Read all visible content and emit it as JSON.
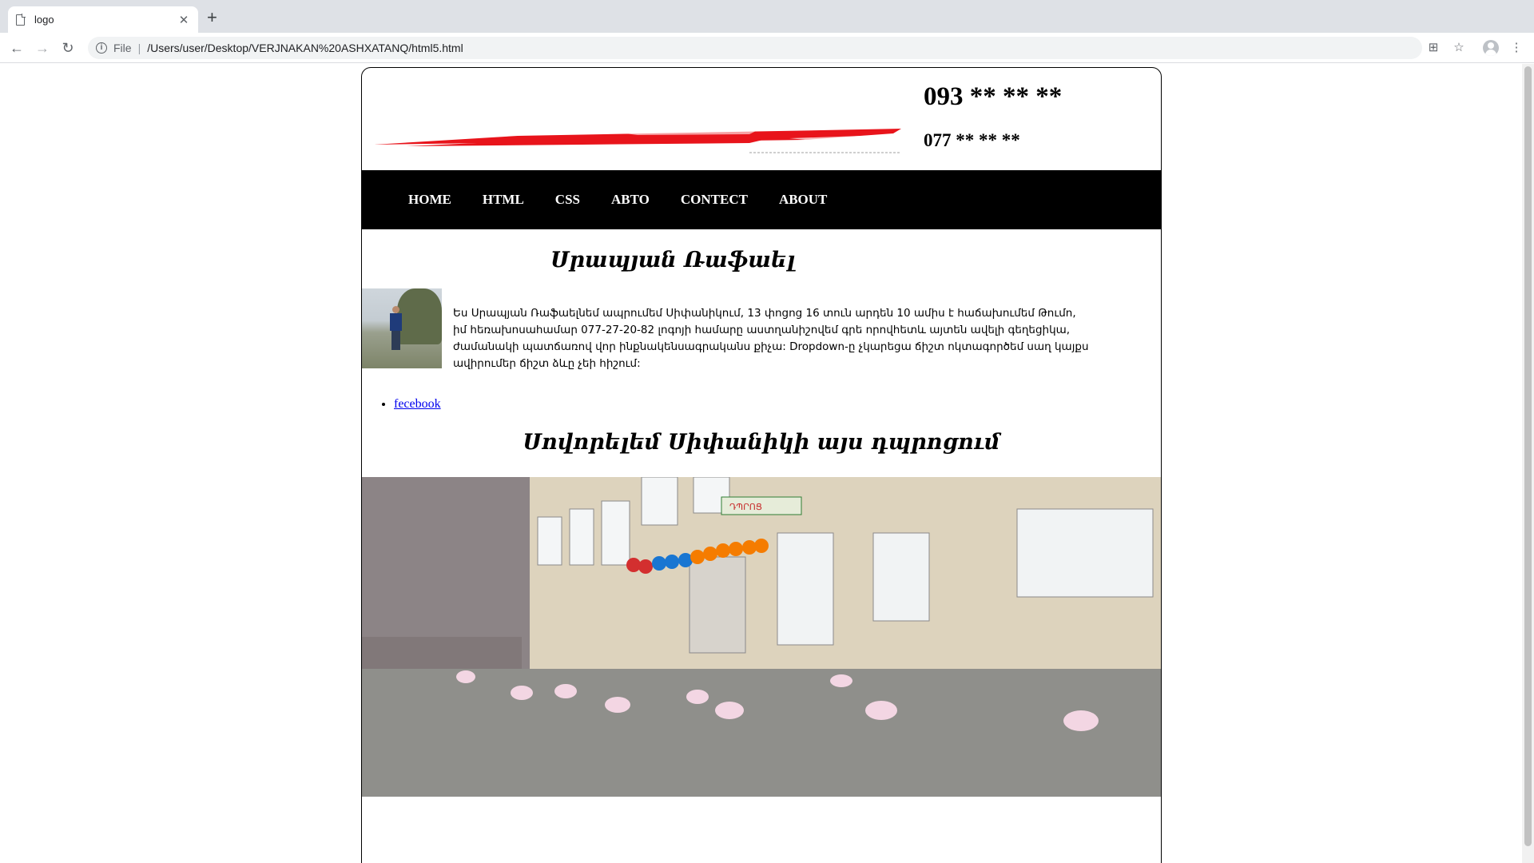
{
  "browser": {
    "tab_title": "logo",
    "tab_close": "✕",
    "new_tab": "+",
    "url_scheme": "File",
    "url": "/Users/user/Desktop/VERJNAKAN%20ASHXATANQ/html5.html"
  },
  "header": {
    "phone_primary": "093 ** ** **",
    "phone_secondary": "077 ** ** **"
  },
  "menu": {
    "items": [
      {
        "label": "HOME"
      },
      {
        "label": "HTML"
      },
      {
        "label": "CSS"
      },
      {
        "label": "ABTO"
      },
      {
        "label": "CONTECT"
      },
      {
        "label": "ABOUT"
      }
    ]
  },
  "profile": {
    "title": "Սրապյան Ռաֆաել",
    "bio": "Ես Սրապյան Ռաֆաելնեմ ապրումեմ Սիփանիկում, 13 փոցոց 16 տուն արդեն 10 ամիս է հաճախումեմ Թումո, իմ հեռախոսահամար 077-27-20-82 լոգոյի համարը աստղանիշովեմ գրե որովհետև այտեն ավելի գեղեցիկա, ժամանակի պատճառով վոր ինքնակենսագրականս քիչա: Dropdown-ը չկարեցա ճիշտ ոկտագործեմ սաղ կայքս ավիրումեր ճիշտ ձևը չեի հիշում:"
  },
  "links": {
    "facebook": "fecebook"
  },
  "school": {
    "title": "Սովորելեմ Սիփանիկի այս դպրոցում",
    "sign_text": "ԴՊՐՈՑ"
  },
  "colors": {
    "menu_bg": "#000000",
    "link": "#0000ee",
    "logo_red": "#e8141b"
  }
}
